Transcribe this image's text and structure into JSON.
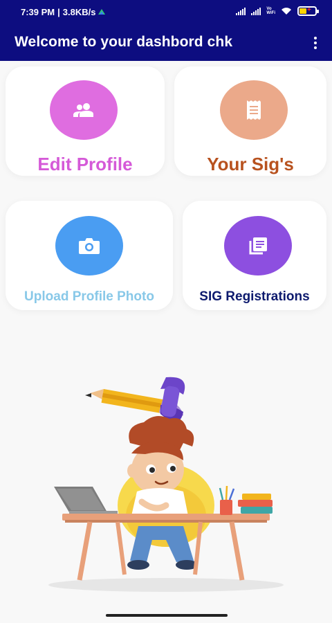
{
  "status_bar": {
    "time": "7:39 PM",
    "separator": "|",
    "speed": "3.8KB/s",
    "volte": "Vo\nWiFi"
  },
  "app_bar": {
    "title": "Welcome to your dashbord chk",
    "menu_icon": "more-vert-icon"
  },
  "cards": [
    {
      "label": "Edit Profile",
      "icon": "people-icon",
      "color": "#d55ad8",
      "circle_color": "#df6de0"
    },
    {
      "label": "Your Sig's",
      "icon": "receipt-icon",
      "color": "#b8521f",
      "circle_color": "#eba98a"
    },
    {
      "label": "Upload Profile Photo",
      "icon": "camera-icon",
      "color": "#88c8e8",
      "circle_color": "#4a9df2"
    },
    {
      "label": "SIG Registrations",
      "icon": "library-books-icon",
      "color": "#0d1a6e",
      "circle_color": "#8d4fe0"
    }
  ],
  "colors": {
    "app_bar": "#0d0d80",
    "background": "#f8f8f8"
  },
  "illustration": "boy-studying-at-desk"
}
